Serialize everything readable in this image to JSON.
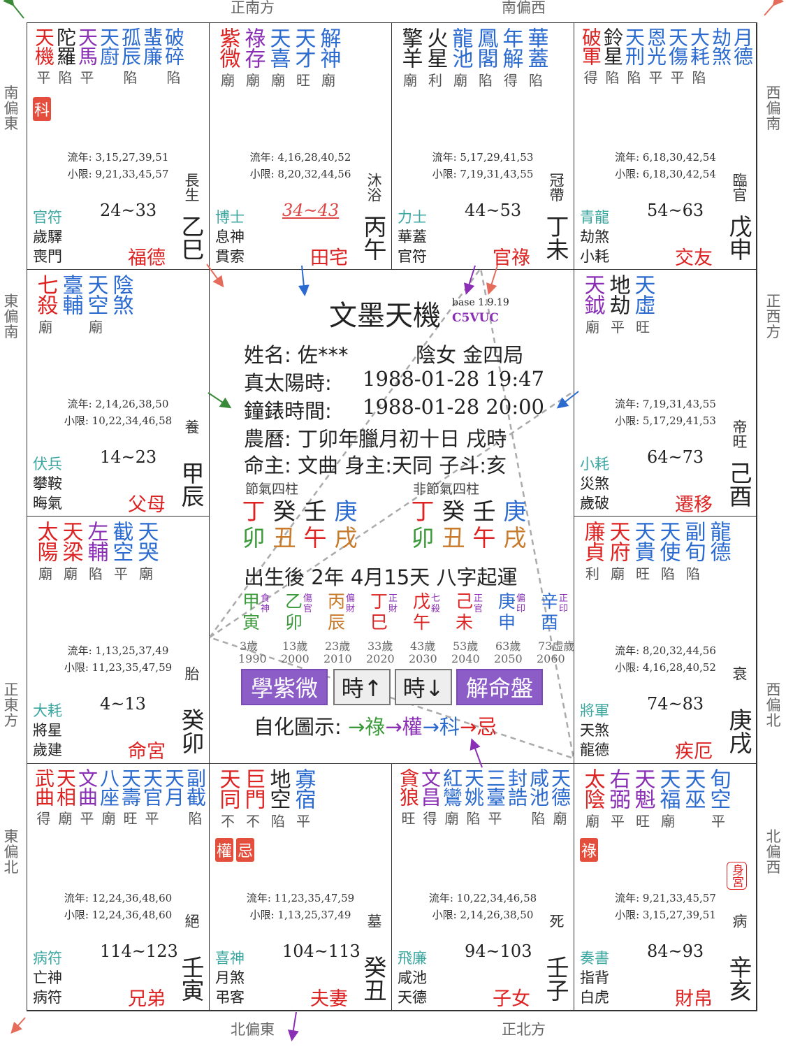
{
  "directions": {
    "top_left": "正南方",
    "top_right": "南偏西",
    "left_1": "南偏東",
    "left_2": "東偏南",
    "left_3": "正東方",
    "left_4": "東偏北",
    "right_1": "西偏南",
    "right_2": "正西方",
    "right_3": "西偏北",
    "right_4": "北偏西",
    "bottom_left": "北偏東",
    "bottom_right": "正北方"
  },
  "colors": {
    "red": "#d22",
    "blue": "#2b6bd0",
    "purple": "#8a2fb5",
    "teal": "#3aa6a0",
    "button": "#8c5cc7"
  },
  "palaces": [
    {
      "id": "si",
      "stars": [
        {
          "name": "天機",
          "color": "red",
          "bright": "平"
        },
        {
          "name": "陀羅",
          "color": "black",
          "bright": "陷"
        },
        {
          "name": "天馬",
          "color": "purple",
          "bright": "平"
        },
        {
          "name": "天廚",
          "color": "blue",
          "bright": ""
        },
        {
          "name": "孤辰",
          "color": "blue",
          "bright": "陷"
        },
        {
          "name": "蜚廉",
          "color": "blue",
          "bright": ""
        },
        {
          "name": "破碎",
          "color": "blue",
          "bright": "陷"
        }
      ],
      "hua": "科",
      "liunian": "流年: 3,15,27,39,51",
      "xiaoxian": "小限: 9,21,33,45,57",
      "range": "24~33",
      "stage": "長生",
      "god1": "官符",
      "god2": "歲驛",
      "god3": "喪門",
      "palace": "福德",
      "gz": "乙巳"
    },
    {
      "id": "wu",
      "stars": [
        {
          "name": "紫微",
          "color": "red",
          "bright": "廟"
        },
        {
          "name": "祿存",
          "color": "purple",
          "bright": "廟"
        },
        {
          "name": "天喜",
          "color": "blue",
          "bright": "廟"
        },
        {
          "name": "天才",
          "color": "blue",
          "bright": "旺"
        },
        {
          "name": "解神",
          "color": "blue",
          "bright": "廟"
        }
      ],
      "hua": "",
      "liunian": "流年: 4,16,28,40,52",
      "xiaoxian": "小限: 8,20,32,44,56",
      "range": "34~43",
      "stage": "沐浴",
      "god1": "博士",
      "god2": "息神",
      "god3": "貫索",
      "palace": "田宅",
      "gz": "丙午"
    },
    {
      "id": "wei",
      "stars": [
        {
          "name": "擎羊",
          "color": "black",
          "bright": "廟"
        },
        {
          "name": "火星",
          "color": "black",
          "bright": "利"
        },
        {
          "name": "龍池",
          "color": "blue",
          "bright": "廟"
        },
        {
          "name": "鳳閣",
          "color": "blue",
          "bright": "陷"
        },
        {
          "name": "年解",
          "color": "blue",
          "bright": "得"
        },
        {
          "name": "華蓋",
          "color": "blue",
          "bright": "陷"
        }
      ],
      "hua": "",
      "liunian": "流年: 5,17,29,41,53",
      "xiaoxian": "小限: 7,19,31,43,55",
      "range": "44~53",
      "stage": "冠帶",
      "god1": "力士",
      "god2": "華蓋",
      "god3": "官符",
      "palace": "官祿",
      "gz": "丁未"
    },
    {
      "id": "shen",
      "stars": [
        {
          "name": "破軍",
          "color": "red",
          "bright": "得"
        },
        {
          "name": "鈴星",
          "color": "black",
          "bright": "陷"
        },
        {
          "name": "天刑",
          "color": "blue",
          "bright": "陷"
        },
        {
          "name": "恩光",
          "color": "blue",
          "bright": "平"
        },
        {
          "name": "天傷",
          "color": "blue",
          "bright": "平"
        },
        {
          "name": "大耗",
          "color": "blue",
          "bright": "陷"
        },
        {
          "name": "劫煞",
          "color": "blue",
          "bright": ""
        },
        {
          "name": "月德",
          "color": "blue",
          "bright": ""
        }
      ],
      "hua": "",
      "liunian": "流年: 6,18,30,42,54",
      "xiaoxian": "小限: 6,18,30,42,54",
      "range": "54~63",
      "stage": "臨官",
      "god1": "青龍",
      "god2": "劫煞",
      "god3": "小耗",
      "palace": "交友",
      "gz": "戊申"
    },
    {
      "id": "chen",
      "stars": [
        {
          "name": "七殺",
          "color": "red",
          "bright": "廟"
        },
        {
          "name": "臺輔",
          "color": "blue",
          "bright": ""
        },
        {
          "name": "天空",
          "color": "blue",
          "bright": "廟"
        },
        {
          "name": "陰煞",
          "color": "blue",
          "bright": ""
        }
      ],
      "hua": "",
      "liunian": "流年: 2,14,26,38,50",
      "xiaoxian": "小限: 10,22,34,46,58",
      "range": "14~23",
      "stage": "養",
      "god1": "伏兵",
      "god2": "攀鞍",
      "god3": "晦氣",
      "palace": "父母",
      "gz": "甲辰"
    },
    {
      "id": "you",
      "stars": [
        {
          "name": "天鉞",
          "color": "purple",
          "bright": "廟"
        },
        {
          "name": "地劫",
          "color": "black",
          "bright": "平"
        },
        {
          "name": "天虛",
          "color": "blue",
          "bright": "旺"
        }
      ],
      "hua": "",
      "liunian": "流年: 7,19,31,43,55",
      "xiaoxian": "小限: 5,17,29,41,53",
      "range": "64~73",
      "stage": "帝旺",
      "god1": "小耗",
      "god2": "災煞",
      "god3": "歲破",
      "palace": "遷移",
      "gz": "己酉"
    },
    {
      "id": "mao",
      "stars": [
        {
          "name": "太陽",
          "color": "red",
          "bright": "廟"
        },
        {
          "name": "天梁",
          "color": "red",
          "bright": "廟"
        },
        {
          "name": "左輔",
          "color": "purple",
          "bright": "陷"
        },
        {
          "name": "截空",
          "color": "blue",
          "bright": "平"
        },
        {
          "name": "天哭",
          "color": "blue",
          "bright": "廟"
        }
      ],
      "hua": "",
      "liunian": "流年: 1,13,25,37,49",
      "xiaoxian": "小限: 11,23,35,47,59",
      "range": "4~13",
      "stage": "胎",
      "god1": "大耗",
      "god2": "將星",
      "god3": "歲建",
      "palace": "命宮",
      "gz": "癸卯"
    },
    {
      "id": "xu",
      "stars": [
        {
          "name": "廉貞",
          "color": "red",
          "bright": "利"
        },
        {
          "name": "天府",
          "color": "red",
          "bright": "廟"
        },
        {
          "name": "天貴",
          "color": "blue",
          "bright": "旺"
        },
        {
          "name": "天使",
          "color": "blue",
          "bright": "陷"
        },
        {
          "name": "副旬",
          "color": "blue",
          "bright": "陷"
        },
        {
          "name": "龍德",
          "color": "blue",
          "bright": ""
        }
      ],
      "hua": "",
      "liunian": "流年: 8,20,32,44,56",
      "xiaoxian": "小限: 4,16,28,40,52",
      "range": "74~83",
      "stage": "衰",
      "god1": "將軍",
      "god2": "天煞",
      "god3": "龍德",
      "palace": "疾厄",
      "gz": "庚戌"
    },
    {
      "id": "yin",
      "stars": [
        {
          "name": "武曲",
          "color": "red",
          "bright": "得"
        },
        {
          "name": "天相",
          "color": "red",
          "bright": "廟"
        },
        {
          "name": "文曲",
          "color": "purple",
          "bright": "平"
        },
        {
          "name": "八座",
          "color": "blue",
          "bright": "廟"
        },
        {
          "name": "天壽",
          "color": "blue",
          "bright": "旺"
        },
        {
          "name": "天官",
          "color": "blue",
          "bright": "平"
        },
        {
          "name": "天月",
          "color": "blue",
          "bright": ""
        },
        {
          "name": "副截",
          "color": "blue",
          "bright": "陷"
        }
      ],
      "hua": "",
      "liunian": "流年: 12,24,36,48,60",
      "xiaoxian": "小限: 12,24,36,48,60",
      "range": "114~123",
      "stage": "絕",
      "god1": "病符",
      "god2": "亡神",
      "god3": "病符",
      "palace": "兄弟",
      "gz": "壬寅"
    },
    {
      "id": "chou",
      "stars": [
        {
          "name": "天同",
          "color": "red",
          "bright": "不"
        },
        {
          "name": "巨門",
          "color": "red",
          "bright": "不"
        },
        {
          "name": "地空",
          "color": "black",
          "bright": "陷"
        },
        {
          "name": "寡宿",
          "color": "blue",
          "bright": "平"
        }
      ],
      "hua": "權忌",
      "liunian": "流年: 11,23,35,47,59",
      "xiaoxian": "小限: 1,13,25,37,49",
      "range": "104~113",
      "stage": "墓",
      "god1": "喜神",
      "god2": "月煞",
      "god3": "弔客",
      "palace": "夫妻",
      "gz": "癸丑"
    },
    {
      "id": "zi",
      "stars": [
        {
          "name": "貪狼",
          "color": "red",
          "bright": "旺"
        },
        {
          "name": "文昌",
          "color": "purple",
          "bright": "得"
        },
        {
          "name": "紅鸞",
          "color": "blue",
          "bright": "廟"
        },
        {
          "name": "天姚",
          "color": "blue",
          "bright": "陷"
        },
        {
          "name": "三臺",
          "color": "blue",
          "bright": "平"
        },
        {
          "name": "封誥",
          "color": "blue",
          "bright": ""
        },
        {
          "name": "咸池",
          "color": "blue",
          "bright": "陷"
        },
        {
          "name": "天德",
          "color": "blue",
          "bright": "廟"
        }
      ],
      "hua": "",
      "liunian": "流年: 10,22,34,46,58",
      "xiaoxian": "小限: 2,14,26,38,50",
      "range": "94~103",
      "stage": "死",
      "god1": "飛廉",
      "god2": "咸池",
      "god3": "天德",
      "palace": "子女",
      "gz": "壬子"
    },
    {
      "id": "hai",
      "stars": [
        {
          "name": "太陰",
          "color": "red",
          "bright": "廟"
        },
        {
          "name": "右弼",
          "color": "purple",
          "bright": "平"
        },
        {
          "name": "天魁",
          "color": "purple",
          "bright": "旺"
        },
        {
          "name": "天福",
          "color": "blue",
          "bright": "廟"
        },
        {
          "name": "天巫",
          "color": "blue",
          "bright": ""
        },
        {
          "name": "旬空",
          "color": "blue",
          "bright": "平"
        }
      ],
      "hua": "祿",
      "liunian": "流年: 9,21,33,45,57",
      "xiaoxian": "小限: 3,15,27,39,51",
      "range": "84~93",
      "stage": "病",
      "god1": "奏書",
      "god2": "指背",
      "god3": "白虎",
      "palace": "財帛",
      "gz": "辛亥",
      "shengong": "身宮"
    }
  ],
  "center": {
    "title": "文墨天機",
    "version": "base 1.9.19",
    "code": "C5VUC",
    "name_label": "姓名: 佐***",
    "gender": "陰女 金四局",
    "true_solar": "真太陽時:",
    "true_solar_val": "1988-01-28  19:47",
    "clock": "鐘錶時間:",
    "clock_val": "1988-01-28  20:00",
    "lunar": "農曆: 丁卯年臘月初十日 戌時",
    "master": "命主: 文曲 身主:天同  子斗:亥",
    "jieqi_label": "節氣四柱",
    "nonjieqi_label": "非節氣四柱",
    "pillars": [
      [
        "丁",
        "卯"
      ],
      [
        "癸",
        "丑"
      ],
      [
        "壬",
        "午"
      ],
      [
        "庚",
        "戌"
      ]
    ],
    "qiyun": "出生後 2年 4月15天 八字起運",
    "dayun": [
      {
        "gan": "甲",
        "zhi": "寅",
        "god": "食神",
        "age": "3歲",
        "year": "1990"
      },
      {
        "gan": "乙",
        "zhi": "卯",
        "god": "傷官",
        "age": "13歲",
        "year": "2000"
      },
      {
        "gan": "丙",
        "zhi": "辰",
        "god": "偏財",
        "age": "23歲",
        "year": "2010"
      },
      {
        "gan": "丁",
        "zhi": "巳",
        "god": "正財",
        "age": "33歲",
        "year": "2020"
      },
      {
        "gan": "戊",
        "zhi": "午",
        "god": "七殺",
        "age": "43歲",
        "year": "2030"
      },
      {
        "gan": "己",
        "zhi": "未",
        "god": "正官",
        "age": "53歲",
        "year": "2040"
      },
      {
        "gan": "庚",
        "zhi": "申",
        "god": "偏印",
        "age": "63歲",
        "year": "2050"
      },
      {
        "gan": "辛",
        "zhi": "酉",
        "god": "正印",
        "age": "73虛歲",
        "year": "2060"
      }
    ],
    "btn_learn": "學紫微",
    "btn_up": "時↑",
    "btn_down": "時↓",
    "btn_explain": "解命盤",
    "legend_label": "自化圖示:",
    "legend_lu": "→祿",
    "legend_quan": "→權",
    "legend_ke": "→科",
    "legend_ji": "→忌"
  }
}
